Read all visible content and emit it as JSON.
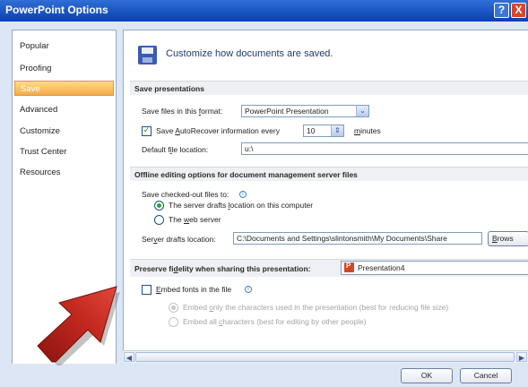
{
  "window": {
    "title": "PowerPoint Options",
    "help_label": "?",
    "close_label": "X"
  },
  "sidebar": {
    "items": [
      {
        "label": "Popular"
      },
      {
        "label": "Proofing"
      },
      {
        "label": "Save"
      },
      {
        "label": "Advanced"
      },
      {
        "label": "Customize"
      },
      {
        "label": "Trust Center"
      },
      {
        "label": "Resources"
      }
    ],
    "selected": "Save"
  },
  "header": {
    "text": "Customize how documents are saved."
  },
  "save_presentations": {
    "section_title": "Save presentations",
    "format_label_pre": "Save files in this ",
    "format_label_u": "f",
    "format_label_post": "ormat:",
    "format_value": "PowerPoint Presentation",
    "autorecover_pre": "Save ",
    "autorecover_u": "A",
    "autorecover_post": "utoRecover information every",
    "autorecover_checked": true,
    "autorecover_minutes": "10",
    "minutes_u": "m",
    "minutes_post": "inutes",
    "default_location_pre": "Default f",
    "default_location_u": "i",
    "default_location_post": "le location:",
    "default_location_value": "u:\\"
  },
  "offline_editing": {
    "section_title": "Offline editing options for document management server files",
    "checkout_label": "Save checked-out files to:",
    "server_drafts_pre": "The server drafts ",
    "server_drafts_u": "l",
    "server_drafts_post": "ocation on this computer",
    "server_drafts_checked": true,
    "web_server_pre": "The ",
    "web_server_u": "w",
    "web_server_post": "eb server",
    "web_server_checked": false,
    "drafts_location_pre": "Ser",
    "drafts_location_u": "v",
    "drafts_location_post": "er drafts location:",
    "drafts_location_value": "C:\\Documents and Settings\\slintonsmith\\My Documents\\Share",
    "browse_pre": "",
    "browse_u": "B",
    "browse_post": "rows"
  },
  "fidelity": {
    "section_pre": "Preserve fi",
    "section_u": "d",
    "section_post": "elity when sharing this presentation:",
    "presentation_value": "Presentation4",
    "embed_u": "E",
    "embed_post": "mbed fonts in the file",
    "embed_checked": false,
    "embed_only_pre": "Embed ",
    "embed_only_u": "o",
    "embed_only_post": "nly the characters used in the presentation (best for reducing file size)",
    "embed_all_pre": "Embed all ",
    "embed_all_u": "c",
    "embed_all_post": "haracters (best for editing by other people)"
  },
  "scrollbar": {
    "left_arrow": "◀",
    "right_arrow": "▶"
  },
  "footer": {
    "ok_label": "OK",
    "cancel_label": "Cancel"
  },
  "colors": {
    "titlebar": "#0a3fb2",
    "selected_nav": "#f6a94a",
    "annotation_arrow": "#b51f1a"
  },
  "icons": {
    "header": "floppy-disk-icon",
    "dropdown": "chevron-down-icon",
    "spinner": "spin-arrows-icon",
    "info": "info-icon",
    "presentation": "powerpoint-file-icon",
    "annotation": "red-arrow"
  }
}
